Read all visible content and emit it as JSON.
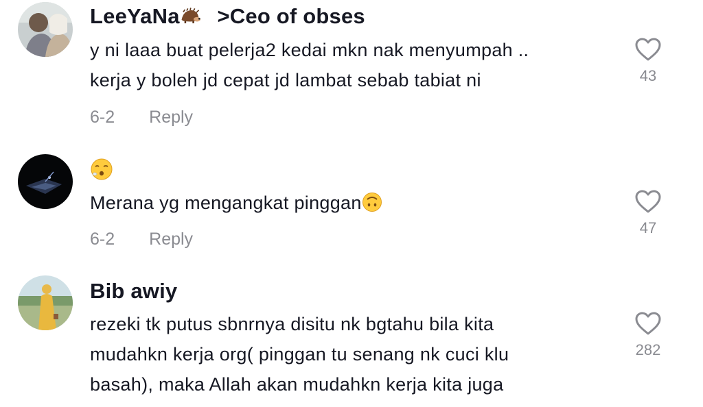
{
  "comments": [
    {
      "username": "LeeYaNa",
      "username_suffix": ">Ceo of obses",
      "username_emoji": "hedgehog-emoji",
      "lines": [
        "y ni laaa buat pelerja2 kedai mkn nak menyumpah ..",
        "kerja y boleh jd cepat jd lambat sebab tabiat ni"
      ],
      "date": "6-2",
      "reply_label": "Reply",
      "likes": "43"
    },
    {
      "username_emoji": "face-exhaling-emoji",
      "lines": [
        "Merana yg mengangkat pinggan"
      ],
      "trailing_emoji": "upside-down-face-emoji",
      "date": "6-2",
      "reply_label": "Reply",
      "likes": "47"
    },
    {
      "username": "Bib awiy",
      "lines": [
        "rezeki tk putus sbnrnya disitu nk bgtahu bila kita",
        "mudahkn kerja org( pinggan tu senang nk cuci klu",
        "basah), maka Allah akan mudahkn kerja kita juga"
      ],
      "likes": "282"
    }
  ],
  "colors": {
    "text": "#161823",
    "secondary": "#8a8b91",
    "icon": "#8a8b91"
  }
}
